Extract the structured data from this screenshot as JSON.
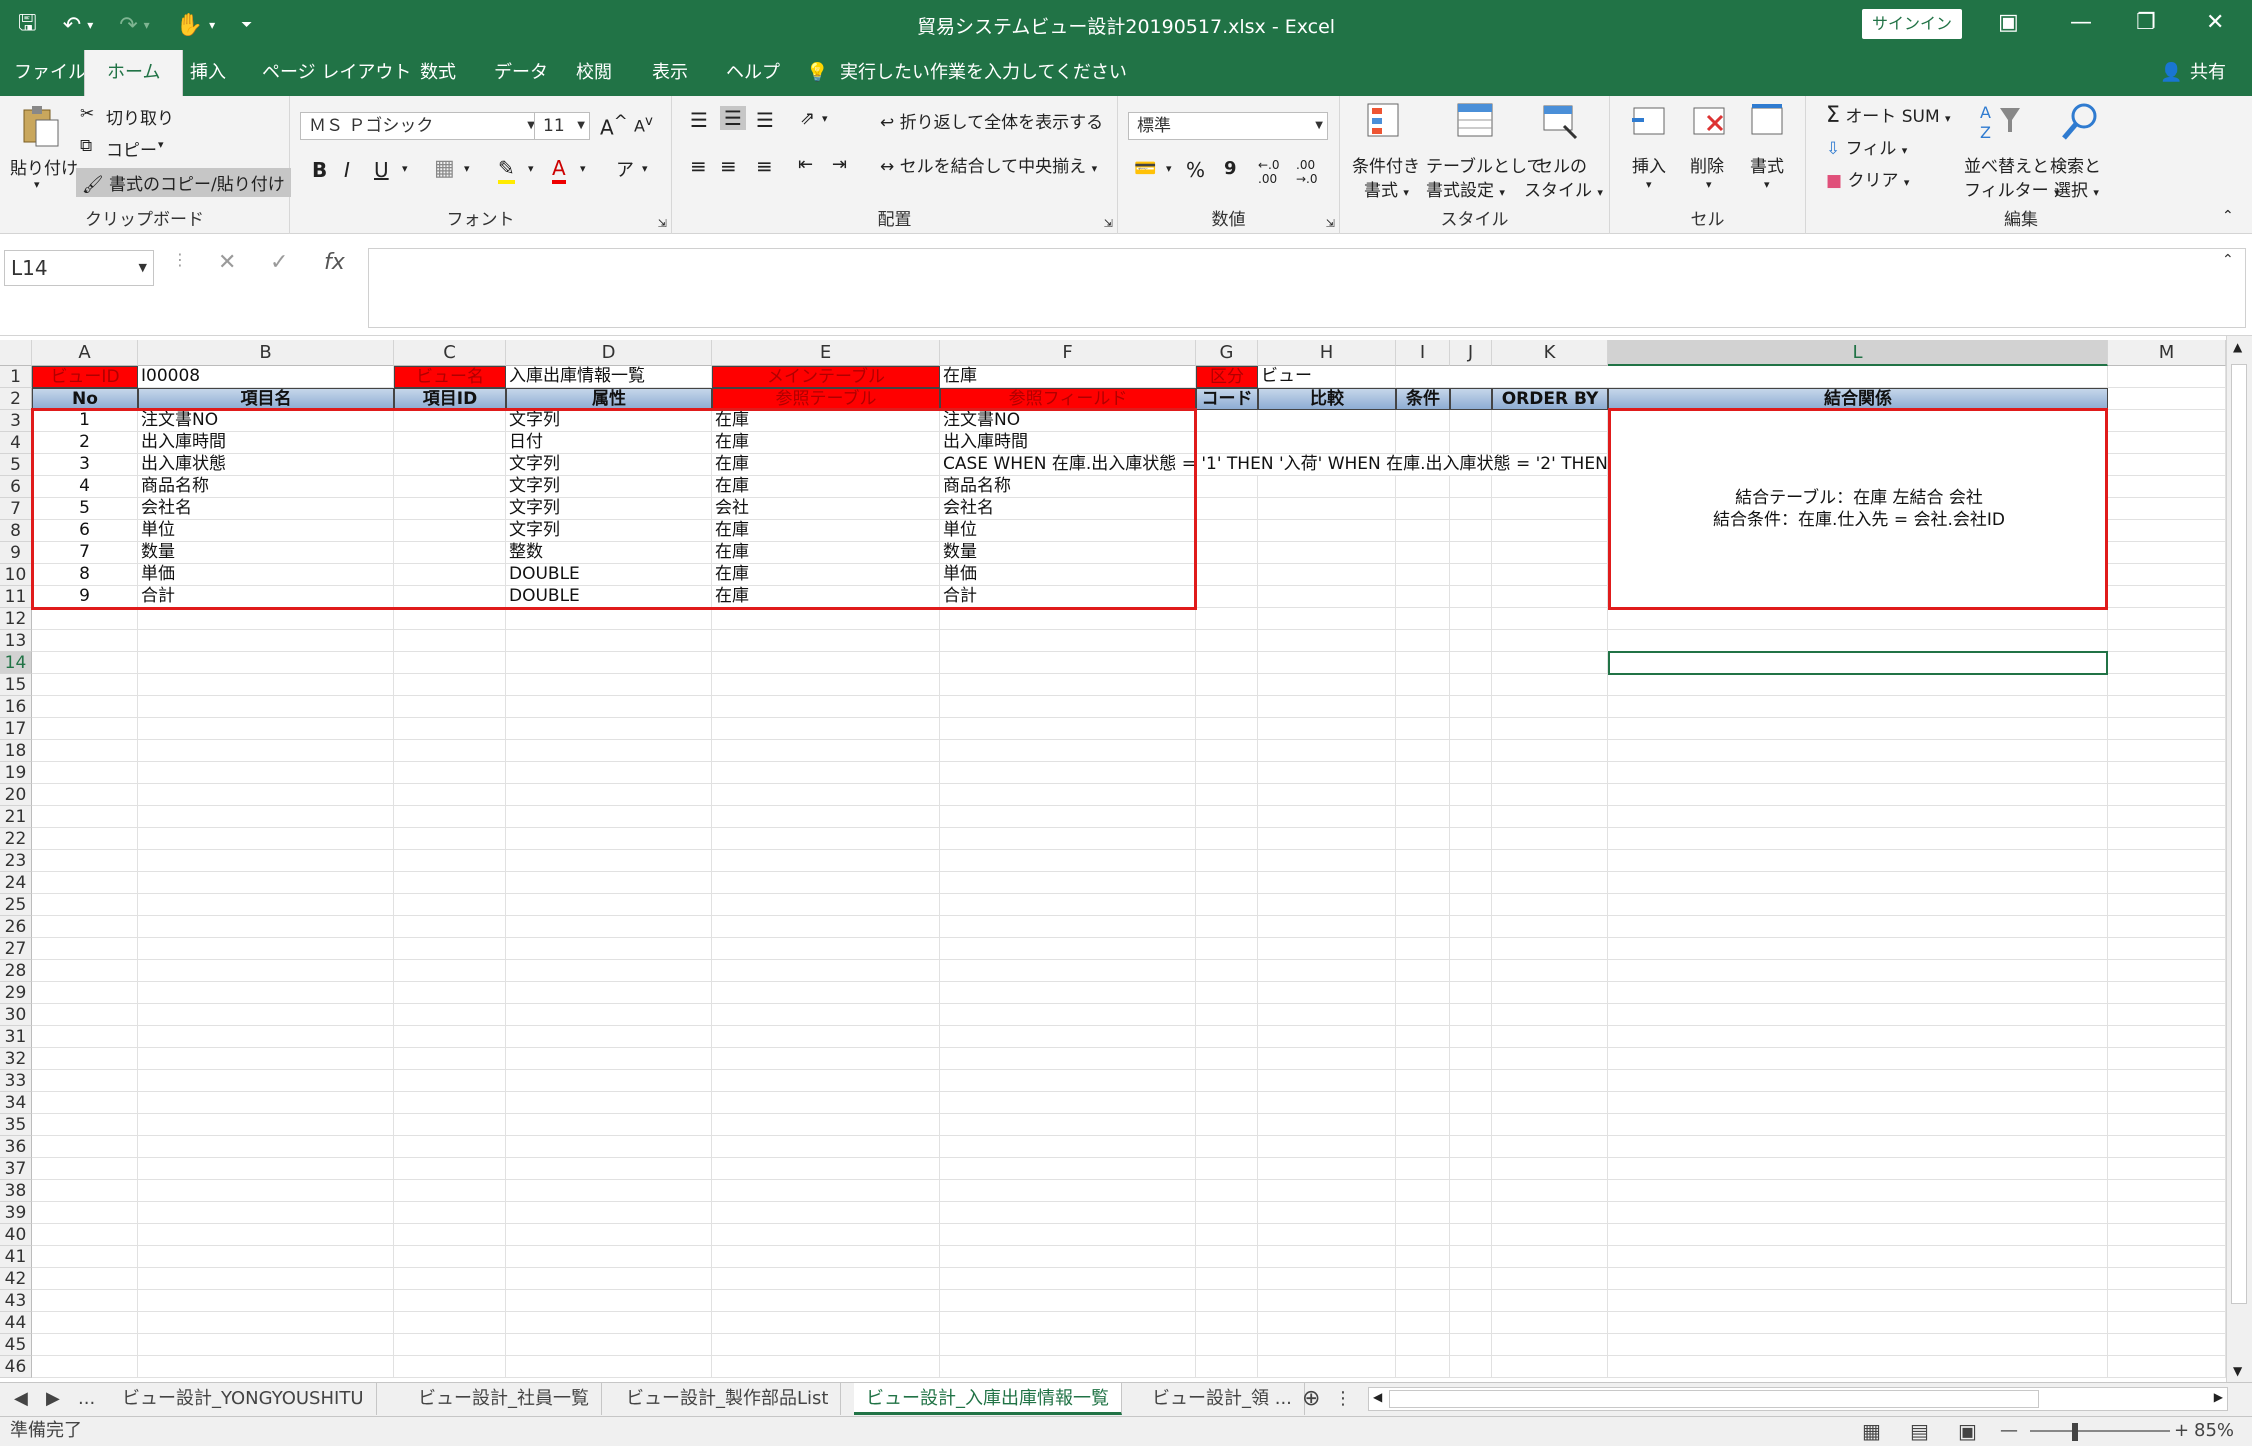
{
  "window": {
    "title": "貿易システムビュー設計20190517.xlsx  -  Excel",
    "signin": "サインイン",
    "share": "共有"
  },
  "tabs": [
    "ファイル",
    "ホーム",
    "挿入",
    "ページ レイアウト",
    "数式",
    "データ",
    "校閲",
    "表示",
    "ヘルプ"
  ],
  "tell_me": "実行したい作業を入力してください",
  "ribbon": {
    "clipboard": {
      "paste": "貼り付け",
      "cut": "切り取り",
      "copy": "コピー",
      "format_painter": "書式のコピー/貼り付け",
      "label": "クリップボード"
    },
    "font": {
      "name": "ＭＳ Ｐゴシック",
      "size": "11",
      "bold": "B",
      "italic": "I",
      "underline": "U",
      "label": "フォント"
    },
    "alignment": {
      "wrap": "折り返して全体を表示する",
      "merge": "セルを結合して中央揃え",
      "label": "配置"
    },
    "number": {
      "format": "標準",
      "percent": "%",
      "comma": "9",
      "label": "数値"
    },
    "styles": {
      "conditional": "条件付き",
      "conditional2": "書式",
      "table": "テーブルとして",
      "table2": "書式設定",
      "cell": "セルの",
      "cell2": "スタイル",
      "label": "スタイル"
    },
    "cells": {
      "insert": "挿入",
      "delete": "削除",
      "format": "書式",
      "label": "セル"
    },
    "editing": {
      "autosum": "オート SUM",
      "fill": "フィル",
      "clear": "クリア",
      "sort": "並べ替えと",
      "sort2": "フィルター",
      "find": "検索と",
      "find2": "選択",
      "label": "編集"
    }
  },
  "formula_bar": {
    "name_box": "L14",
    "fx": "fx",
    "value": ""
  },
  "columns": [
    "A",
    "B",
    "C",
    "D",
    "E",
    "F",
    "G",
    "H",
    "I",
    "J",
    "K",
    "L",
    "M"
  ],
  "row_numbers": [
    "1",
    "2",
    "3",
    "4",
    "5",
    "6",
    "7",
    "8",
    "9",
    "10",
    "11",
    "12",
    "13",
    "14",
    "15",
    "16",
    "17",
    "18",
    "19",
    "20",
    "21",
    "22",
    "23",
    "24",
    "25",
    "26",
    "27",
    "28",
    "29",
    "30",
    "31",
    "32",
    "33",
    "34",
    "35",
    "36",
    "37",
    "38",
    "39",
    "40",
    "41",
    "42",
    "43",
    "44",
    "45",
    "46"
  ],
  "sheet": {
    "row1": {
      "view_id_label": "ビューID",
      "view_id": "I00008",
      "view_name_label": "ビュー名",
      "view_name": "入庫出庫情報一覧",
      "main_table_label": "メインテーブル",
      "main_table": "在庫",
      "kind_label": "区分",
      "kind": "ビュー"
    },
    "headers": [
      "No",
      "項目名",
      "項目ID",
      "属性",
      "参照テーブル",
      "参照フィールド",
      "コード",
      "比較",
      "条件",
      "",
      "ORDER BY",
      "結合関係"
    ],
    "rows": [
      {
        "no": "1",
        "name": "注文書NO",
        "id": "",
        "attr": "文字列",
        "table": "在庫",
        "field": "注文書NO"
      },
      {
        "no": "2",
        "name": "出入庫時間",
        "id": "",
        "attr": "日付",
        "table": "在庫",
        "field": "出入庫時間"
      },
      {
        "no": "3",
        "name": "出入庫状態",
        "id": "",
        "attr": "文字列",
        "table": "在庫",
        "field": "CASE WHEN 在庫.出入庫状態 = '1' THEN '入荷' WHEN 在庫.出入庫状態 = '2' THEN"
      },
      {
        "no": "4",
        "name": "商品名称",
        "id": "",
        "attr": "文字列",
        "table": "在庫",
        "field": "商品名称"
      },
      {
        "no": "5",
        "name": "会社名",
        "id": "",
        "attr": "文字列",
        "table": "会社",
        "field": "会社名"
      },
      {
        "no": "6",
        "name": "単位",
        "id": "",
        "attr": "文字列",
        "table": "在庫",
        "field": "単位"
      },
      {
        "no": "7",
        "name": "数量",
        "id": "",
        "attr": "整数",
        "table": "在庫",
        "field": "数量"
      },
      {
        "no": "8",
        "name": "単価",
        "id": "",
        "attr": "DOUBLE",
        "table": "在庫",
        "field": "単価"
      },
      {
        "no": "9",
        "name": "合計",
        "id": "",
        "attr": "DOUBLE",
        "table": "在庫",
        "field": "合計"
      }
    ],
    "join_text1": "結合テーブル：在庫 左結合 会社",
    "join_text2": "結合条件：在庫.仕入先 = 会社.会社ID"
  },
  "sheet_tabs": [
    "ビュー設計_YONGYOUSHITU",
    "ビュー設計_社員一覧",
    "ビュー設計_製作部品List",
    "ビュー設計_入庫出庫情報一覧",
    "ビュー設計_領 ..."
  ],
  "status": {
    "ready": "準備完了",
    "zoom": "85%"
  }
}
